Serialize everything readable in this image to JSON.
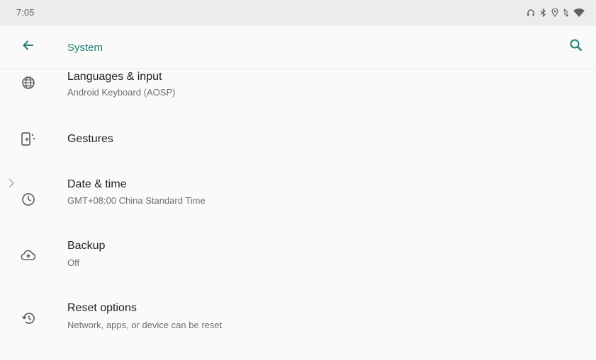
{
  "status_bar": {
    "time": "7:05",
    "icons": [
      "headset-icon",
      "bluetooth-icon",
      "location-icon",
      "data-arrows-icon",
      "wifi-icon"
    ]
  },
  "app_bar": {
    "title": "System",
    "back_icon": "arrow-back-icon",
    "search_icon": "search-icon",
    "accent_color": "#1e8272"
  },
  "items": [
    {
      "title": "Languages & input",
      "summary": "Android Keyboard (AOSP)",
      "icon": "globe-icon"
    },
    {
      "title": "Gestures",
      "summary": "",
      "icon": "gestures-phone-icon"
    },
    {
      "title": "Date & time",
      "summary": "GMT+08:00 China Standard Time",
      "icon": "clock-icon"
    },
    {
      "title": "Backup",
      "summary": "Off",
      "icon": "cloud-upload-icon"
    },
    {
      "title": "Reset options",
      "summary": "Network, apps, or device can be reset",
      "icon": "restore-icon"
    }
  ]
}
